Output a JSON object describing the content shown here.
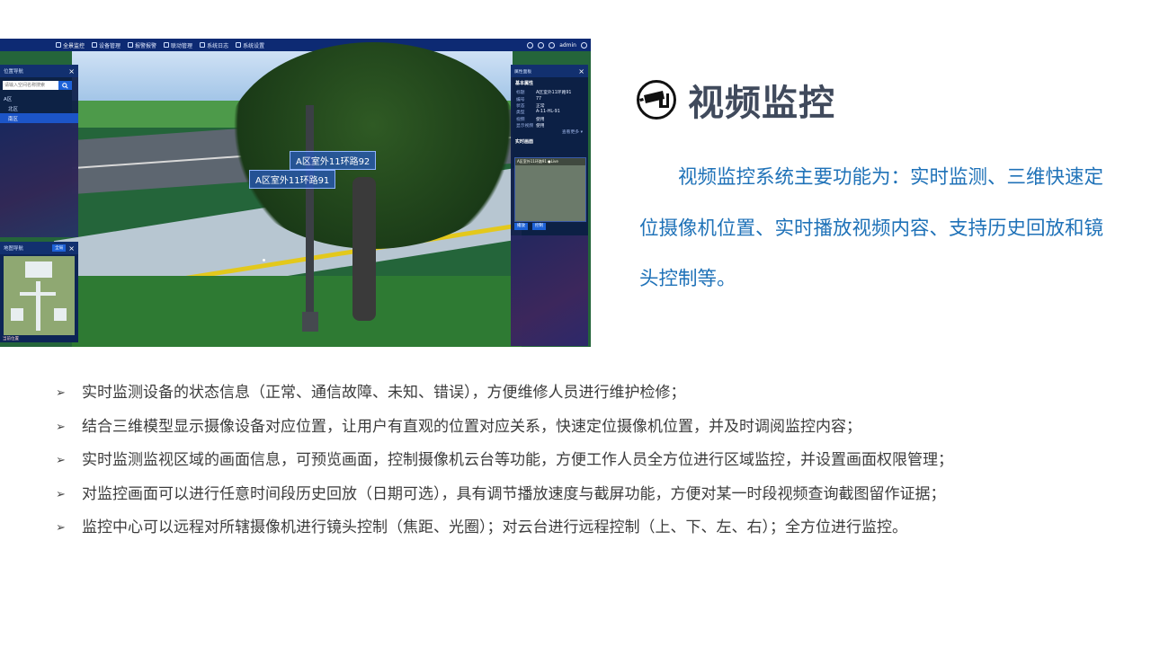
{
  "screenshot": {
    "menu": [
      {
        "label": "全景监控",
        "active": true
      },
      {
        "label": "设备管理",
        "active": false
      },
      {
        "label": "报警报警",
        "active": false
      },
      {
        "label": "联动管理",
        "active": false
      },
      {
        "label": "系统日志",
        "active": false
      },
      {
        "label": "系统设置",
        "active": false
      }
    ],
    "user": "admin",
    "nav_panel": {
      "title": "位置导航",
      "search_placeholder": "请输入空间名称搜索",
      "tree": [
        "A区",
        "北区",
        "南区"
      ]
    },
    "scene_labels": [
      "A区室外11环路92",
      "A区室外11环路91"
    ],
    "minimap_panel": {
      "title": "地图导航",
      "badge": "全局",
      "footer": "当前位置"
    },
    "prop_panel": {
      "title": "属性面板",
      "section_basic": "基本属性",
      "rows": [
        {
          "k": "标题",
          "v": "A区室外11环路91"
        },
        {
          "k": "编号",
          "v": "77"
        },
        {
          "k": "状态",
          "v": "正常"
        },
        {
          "k": "类型",
          "v": "A-11-HL-91"
        },
        {
          "k": "视频",
          "v": "使用"
        },
        {
          "k": "显示视频",
          "v": "使用"
        }
      ],
      "more": "查看更多 ▾",
      "section_video": "实时画面",
      "video_title": "A区室外11环路91 ●Live",
      "btn_play": "播放",
      "btn_ctrl": "控制"
    }
  },
  "page": {
    "title": "视频监控",
    "description": "视频监控系统主要功能为：实时监测、三维快速定位摄像机位置、实时播放视频内容、支持历史回放和镜头控制等。",
    "bullet_marker": "➢",
    "bullets": [
      "实时监测设备的状态信息（正常、通信故障、未知、错误），方便维修人员进行维护检修；",
      "结合三维模型显示摄像设备对应位置，让用户有直观的位置对应关系，快速定位摄像机位置，并及时调阅监控内容；",
      "实时监测监视区域的画面信息，可预览画面，控制摄像机云台等功能，方便工作人员全方位进行区域监控，并设置画面权限管理；",
      "对监控画面可以进行任意时间段历史回放（日期可选），具有调节播放速度与截屏功能，方便对某一时段视频查询截图留作证据；",
      "监控中心可以远程对所辖摄像机进行镜头控制（焦距、光圈）；对云台进行远程控制（上、下、左、右）；全方位进行监控。"
    ]
  },
  "colors": {
    "title": "#404a5c",
    "description": "#1f72b8",
    "bullet_text": "#3c3c3c",
    "app_topbar": "#0d2a73"
  }
}
